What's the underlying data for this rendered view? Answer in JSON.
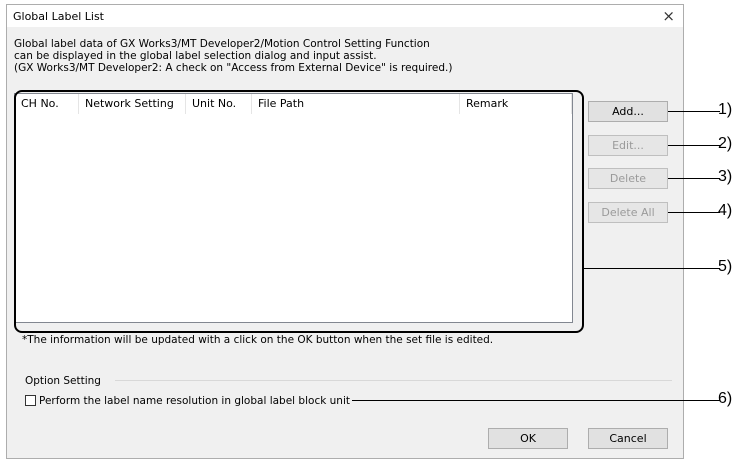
{
  "window": {
    "title": "Global Label List",
    "close_glyph": "×"
  },
  "description": {
    "lines": [
      "Global label data of GX Works3/MT Developer2/Motion Control Setting Function",
      "can be displayed in the global label selection dialog and input assist.",
      "(GX Works3/MT Developer2: A check on \"Access from External Device\" is required.)"
    ]
  },
  "table": {
    "columns": [
      "CH No.",
      "Network Setting",
      "Unit No.",
      "File Path",
      "Remark"
    ],
    "rows": []
  },
  "buttons": {
    "add": "Add...",
    "edit": "Edit...",
    "delete": "Delete",
    "delete_all": "Delete All",
    "ok": "OK",
    "cancel": "Cancel"
  },
  "note": "*The information will be updated with a click on the OK button when the set file is edited.",
  "option_setting": {
    "title": "Option Setting",
    "checkbox_label": "Perform the label name resolution in global label block unit",
    "checked": false
  },
  "callouts": [
    "1)",
    "2)",
    "3)",
    "4)",
    "5)",
    "6)"
  ]
}
